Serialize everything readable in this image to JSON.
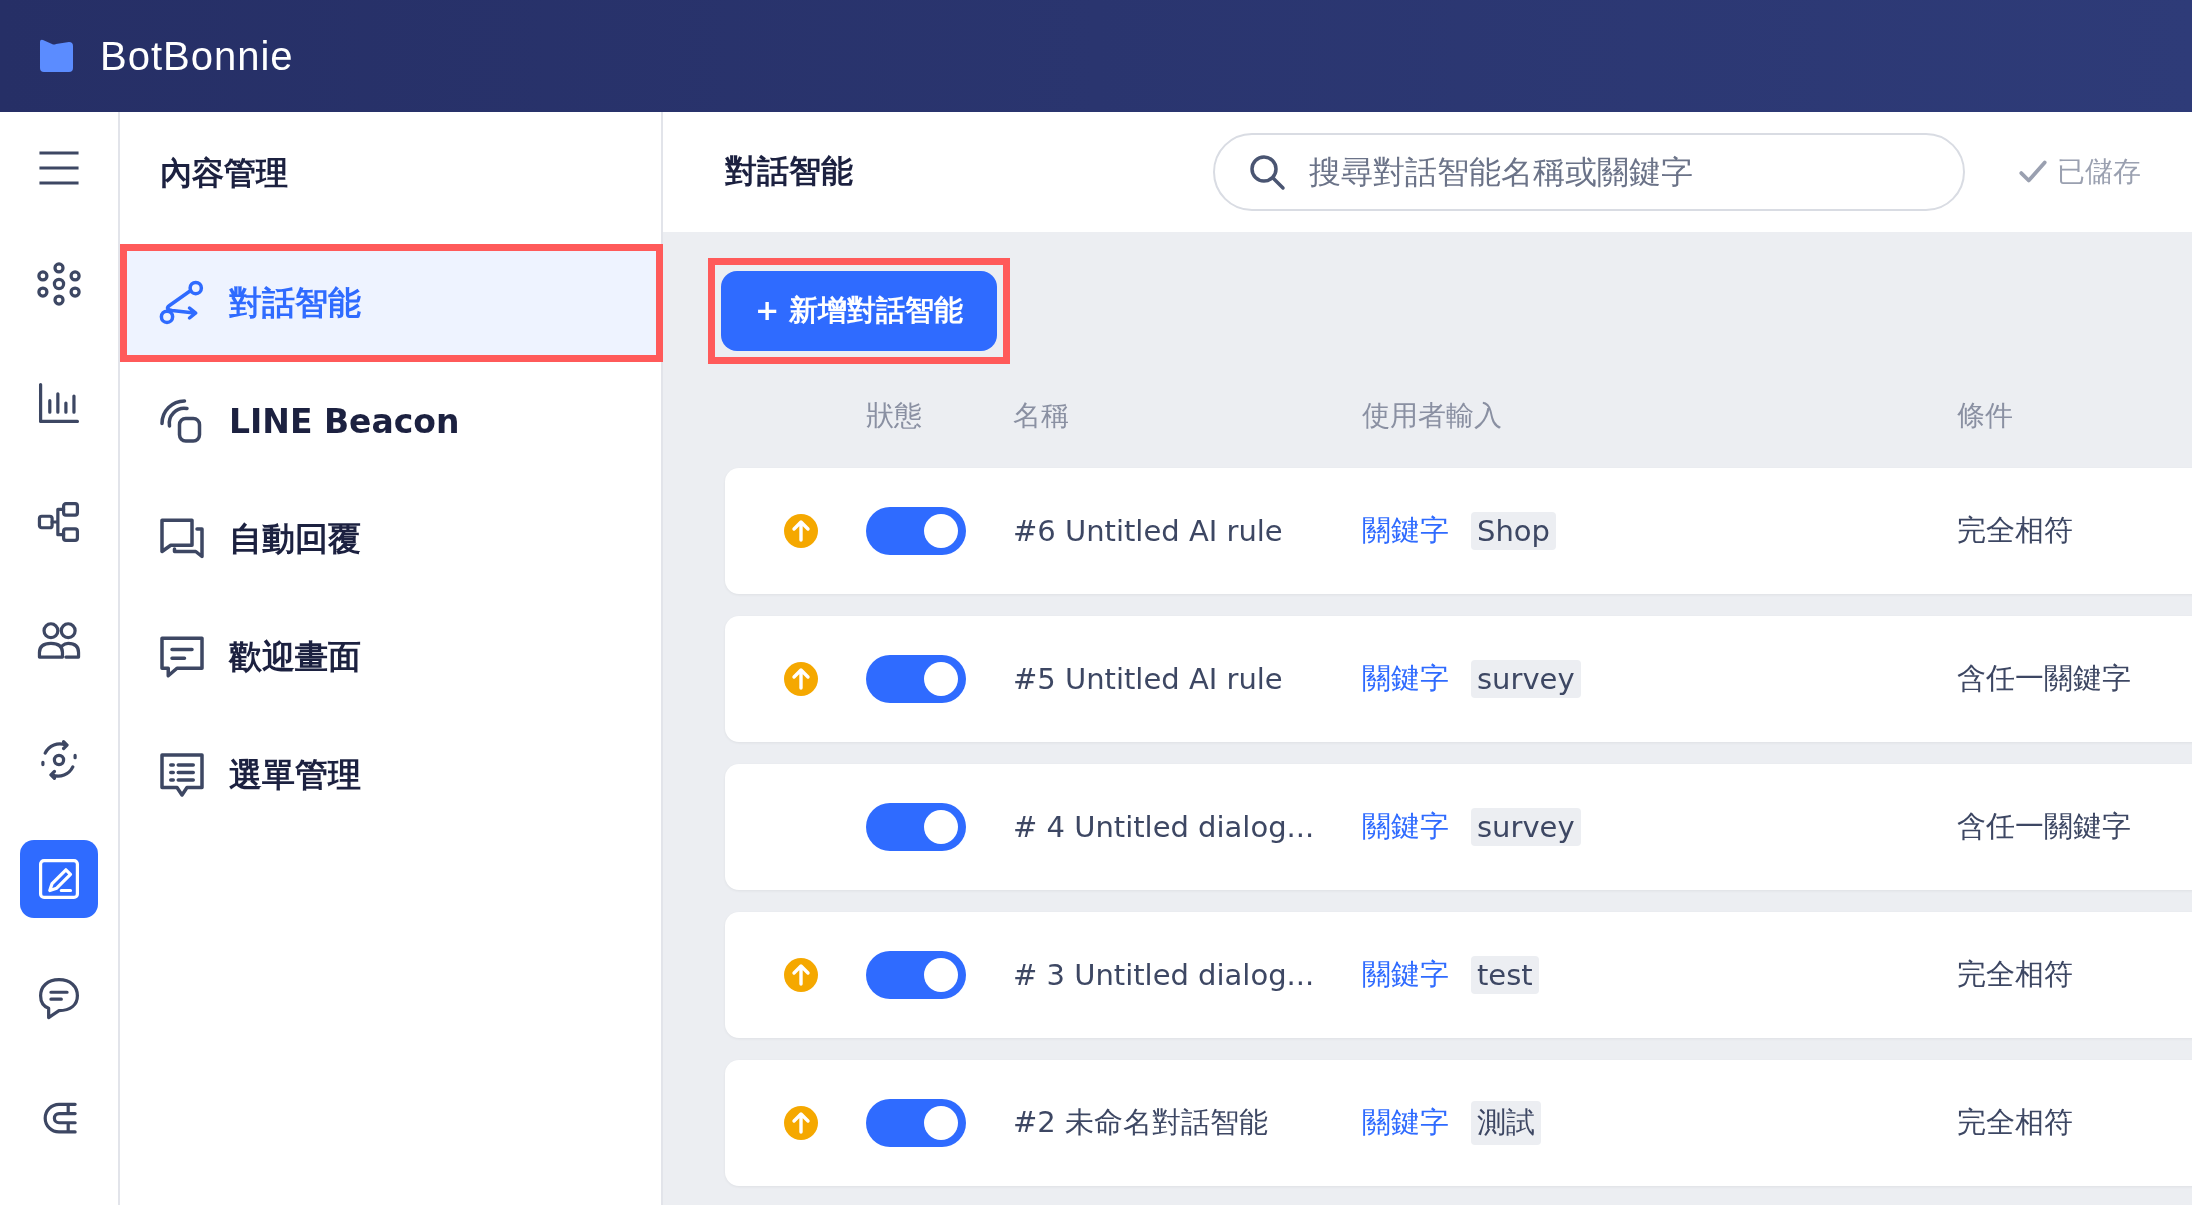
{
  "header": {
    "brand": "BotBonnie"
  },
  "rail": [
    {
      "selected": false
    },
    {
      "selected": false
    },
    {
      "selected": false
    },
    {
      "selected": false
    },
    {
      "selected": false
    },
    {
      "selected": true
    },
    {
      "selected": false
    },
    {
      "selected": false
    }
  ],
  "sidebar": {
    "title": "內容管理",
    "items": [
      {
        "label": "對話智能",
        "selected": true,
        "highlighted": true
      },
      {
        "label": "LINE Beacon",
        "selected": false,
        "highlighted": false
      },
      {
        "label": "自動回覆",
        "selected": false,
        "highlighted": false
      },
      {
        "label": "歡迎畫面",
        "selected": false,
        "highlighted": false
      },
      {
        "label": "選單管理",
        "selected": false,
        "highlighted": false
      }
    ]
  },
  "page": {
    "title": "對話智能",
    "search": {
      "placeholder": "搜尋對話智能名稱或關鍵字"
    },
    "save_status": "已儲存",
    "add_button": {
      "label": "+ 新增對話智能",
      "highlighted": true
    }
  },
  "table": {
    "columns": [
      "狀態",
      "名稱",
      "使用者輸入",
      "條件"
    ],
    "rows": [
      {
        "upgrade": true,
        "on": true,
        "name": "#6 Untitled AI rule",
        "input_type": "關鍵字",
        "keyword": "Shop",
        "condition": "完全相符"
      },
      {
        "upgrade": true,
        "on": true,
        "name": "#5 Untitled AI rule",
        "input_type": "關鍵字",
        "keyword": "survey",
        "condition": "含任一關鍵字"
      },
      {
        "upgrade": false,
        "on": true,
        "name": "# 4 Untitled dialog...",
        "input_type": "關鍵字",
        "keyword": "survey",
        "condition": "含任一關鍵字"
      },
      {
        "upgrade": true,
        "on": true,
        "name": "# 3 Untitled dialog...",
        "input_type": "關鍵字",
        "keyword": "test",
        "condition": "完全相符"
      },
      {
        "upgrade": true,
        "on": true,
        "name": "#2 未命名對話智能",
        "input_type": "關鍵字",
        "keyword": "測試",
        "condition": "完全相符"
      }
    ]
  }
}
